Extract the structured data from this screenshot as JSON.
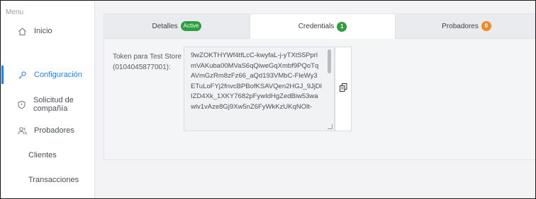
{
  "sidebar": {
    "menu_label": "Menu",
    "items": [
      {
        "label": "Inicio",
        "icon": "home-icon",
        "active": false
      },
      {
        "label": "Configuración",
        "icon": "key-icon",
        "active": true
      },
      {
        "label": "Solicitud de compañía",
        "icon": "shield-icon",
        "active": false
      },
      {
        "label": "Probadores",
        "icon": "group-icon",
        "active": false
      },
      {
        "label": "Clientes",
        "icon": "",
        "active": false
      },
      {
        "label": "Transacciones",
        "icon": "",
        "active": false
      }
    ]
  },
  "tabs": [
    {
      "label": "Detalles",
      "badge": "Active",
      "badge_color": "#2e9e3e"
    },
    {
      "label": "Credentials",
      "badge": "1",
      "badge_color": "#2e9e3e"
    },
    {
      "label": "Probadores",
      "badge": "0",
      "badge_color": "#f08a24"
    }
  ],
  "credentials": {
    "token_label": "Token para Test Store (0104045877001):",
    "token_value": "9wZOKTHYWf4tfLcC-kwyfaL-j-yTXtS5PprlmVAKuba00MVaS6qQiweGqXmbf9PQoTqAVmGzRm8zFz66_aQd193VMbC-FleWy3ETuLoFYj2fnvcBPBofKSAVQen2HGJ_9JjDlIZD4Xk_1XKY7682pFywIdHgZedBiw53wawlv1vAze8Gj9Xw5nZ6FyWkKzUKqNOlt-",
    "copy_icon": "copy-icon"
  },
  "colors": {
    "accent": "#2b7de9",
    "badge_green": "#2e9e3e",
    "badge_orange": "#f08a24"
  }
}
